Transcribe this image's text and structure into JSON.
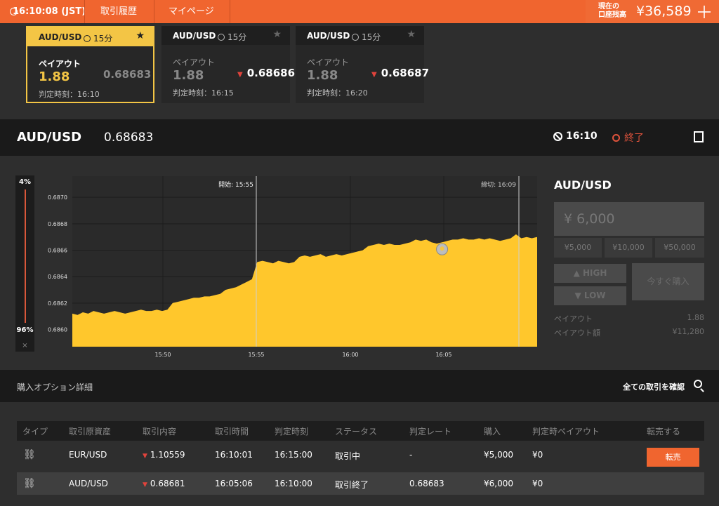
{
  "topbar": {
    "time": "16:10:08 (JST)",
    "nav_history": "取引履歴",
    "nav_mypage": "マイページ",
    "balance_label_1": "現在の",
    "balance_label_2": "口座残高",
    "balance_value": "¥36,589"
  },
  "cards": [
    {
      "pair": "AUD/USD",
      "tf": "15分",
      "payout_label": "ペイアウト",
      "payout": "1.88",
      "rate": "0.68683",
      "judge": "判定時刻：16:10"
    },
    {
      "pair": "AUD/USD",
      "tf": "15分",
      "payout_label": "ペイアウト",
      "payout": "1.88",
      "rate": "0.68686",
      "judge": "判定時刻：16:15"
    },
    {
      "pair": "AUD/USD",
      "tf": "15分",
      "payout_label": "ペイアウト",
      "payout": "1.88",
      "rate": "0.68687",
      "judge": "判定時刻：16:20"
    }
  ],
  "instrument": {
    "symbol": "AUD/USD",
    "price": "0.68683",
    "expiry": "16:10",
    "status": "終了"
  },
  "sentiment": {
    "top": "4%",
    "bottom": "96%",
    "close": "×"
  },
  "chart_data": {
    "type": "area",
    "title": "",
    "xlabel": "",
    "ylabel": "",
    "y_ticks": [
      "0.6870",
      "0.6868",
      "0.6866",
      "0.6864",
      "0.6862",
      "0.6860"
    ],
    "x_ticks": [
      "15:50",
      "15:55",
      "16:00",
      "16:05"
    ],
    "ylim": [
      0.68587,
      0.68716
    ],
    "start_label": "開始: 15:55",
    "end_label": "締切: 16:09",
    "color": "#ffc72c",
    "series": [
      {
        "values": [
          0.68612,
          0.68611,
          0.68613,
          0.68612,
          0.68614,
          0.68613,
          0.68612,
          0.68613,
          0.68614,
          0.68613,
          0.68612,
          0.68613,
          0.68614,
          0.68615,
          0.68614,
          0.68614,
          0.68615,
          0.68614,
          0.68615,
          0.6862,
          0.68621,
          0.68622,
          0.68623,
          0.68624,
          0.68624,
          0.68625,
          0.68625,
          0.68626,
          0.68627,
          0.6863,
          0.68631,
          0.68632,
          0.68634,
          0.68636,
          0.68638,
          0.68651,
          0.68652,
          0.68651,
          0.6865,
          0.68652,
          0.68651,
          0.6865,
          0.68651,
          0.68655,
          0.68656,
          0.68655,
          0.68656,
          0.68657,
          0.68655,
          0.68656,
          0.68657,
          0.68656,
          0.68657,
          0.68658,
          0.68659,
          0.6866,
          0.68663,
          0.68664,
          0.68665,
          0.68664,
          0.68665,
          0.68664,
          0.68664,
          0.68665,
          0.68666,
          0.68668,
          0.68667,
          0.68668,
          0.68666,
          0.68665,
          0.68666,
          0.68667,
          0.68668,
          0.68668,
          0.68669,
          0.68668,
          0.68668,
          0.68669,
          0.68668,
          0.68669,
          0.68668,
          0.68667,
          0.68668,
          0.68669,
          0.68672,
          0.68669,
          0.6867,
          0.68669,
          0.6867
        ]
      }
    ]
  },
  "order": {
    "symbol": "AUD/USD",
    "amount": "¥ 6,000",
    "quick": [
      "¥5,000",
      "¥10,000",
      "¥50,000"
    ],
    "high": "HIGH",
    "low": "LOW",
    "buy": "今すぐ購入",
    "payout_label": "ペイアウト",
    "payout_value": "1.88",
    "payout_amt_label": "ペイアウト額",
    "payout_amt_value": "¥11,280"
  },
  "details": {
    "title": "購入オプション詳細",
    "all_link": "全ての取引を確認",
    "headers": [
      "タイプ",
      "取引原資産",
      "取引内容",
      "取引時間",
      "判定時刻",
      "ステータス",
      "判定レート",
      "購入",
      "判定時ペイアウト",
      "転売する"
    ],
    "rows": [
      {
        "asset": "EUR/USD",
        "content": "1.10559",
        "time": "16:10:01",
        "judge": "16:15:00",
        "status": "取引中",
        "rate": "-",
        "buy": "¥5,000",
        "payout": "¥0",
        "resell": "転売"
      },
      {
        "asset": "AUD/USD",
        "content": "0.68681",
        "time": "16:05:06",
        "judge": "16:10:00",
        "status": "取引終了",
        "rate": "0.68683",
        "buy": "¥6,000",
        "payout": "¥0",
        "resell": ""
      }
    ]
  }
}
